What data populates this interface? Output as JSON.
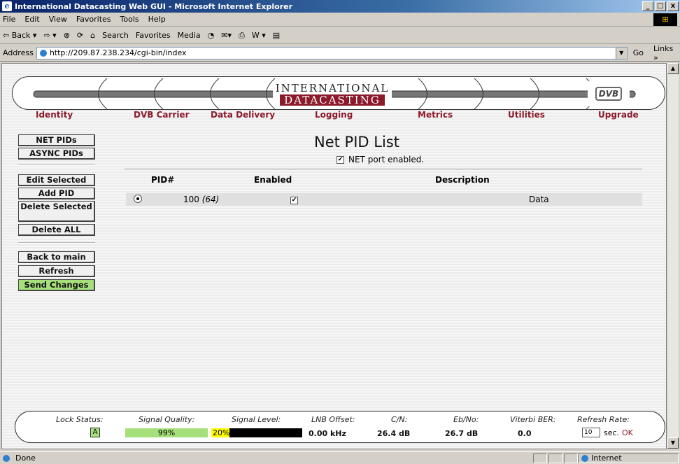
{
  "window": {
    "title": "International Datacasting Web GUI - Microsoft Internet Explorer",
    "controls": [
      "_",
      "□",
      "x"
    ]
  },
  "menubar": [
    "File",
    "Edit",
    "View",
    "Favorites",
    "Tools",
    "Help"
  ],
  "toolbar": {
    "back": "⇦ Back ▾",
    "forward": "⇨ ▾",
    "stop": "⊗",
    "refresh": "⟳",
    "home": "⌂",
    "search": "Search",
    "favorites": "Favorites",
    "media": "Media",
    "history": "◔",
    "mail": "✉▾",
    "print": "⎙",
    "edit": "W ▾",
    "discuss": "▤"
  },
  "address": {
    "label": "Address",
    "url": "http://209.87.238.234/cgi-bin/index",
    "go": "Go",
    "links": "Links »"
  },
  "banner": {
    "logo_line1": "INTERNATIONAL",
    "logo_line2": "DATACASTING",
    "dvb": "DVB"
  },
  "nav": [
    {
      "label": "Identity"
    },
    {
      "label": "DVB Carrier"
    },
    {
      "label": "Data Delivery"
    },
    {
      "label": "Logging"
    },
    {
      "label": "Metrics"
    },
    {
      "label": "Utilities"
    },
    {
      "label": "Upgrade"
    }
  ],
  "sidemenu": {
    "net_pids": "NET PIDs",
    "async_pids": "ASYNC PIDs",
    "edit_selected": "Edit Selected",
    "add_pid": "Add PID",
    "delete_selected": "Delete Selected",
    "delete_all": "Delete ALL",
    "back_to_main": "Back to main",
    "refresh": "Refresh",
    "send_changes": "Send Changes"
  },
  "content": {
    "title": "Net PID List",
    "net_port_label": "NET port enabled.",
    "net_port_checked": true,
    "columns": {
      "pid": "PID#",
      "enabled": "Enabled",
      "description": "Description"
    },
    "rows": [
      {
        "pid": "100",
        "pid_hex": "(64)",
        "enabled": true,
        "description": "Data",
        "selected": true
      }
    ]
  },
  "status": {
    "lock_label": "Lock Status:",
    "lock_value": "A",
    "signal_quality_label": "Signal Quality:",
    "signal_quality_value": "99%",
    "signal_quality_fraction": 0.99,
    "signal_level_label": "Signal Level:",
    "signal_level_value": "20%",
    "signal_level_fraction": 0.2,
    "lnb_label": "LNB Offset:",
    "lnb_value": "0.00 kHz",
    "cn_label": "C/N:",
    "cn_value": "26.4 dB",
    "ebno_label": "Eb/No:",
    "ebno_value": "26.7 dB",
    "ber_label": "Viterbi BER:",
    "ber_value": "0.0",
    "refresh_label": "Refresh Rate:",
    "refresh_value": "10",
    "refresh_unit": "sec.",
    "refresh_ok": "OK"
  },
  "iestatus": {
    "text": "Done",
    "zone": "Internet"
  },
  "colors": {
    "nav": "#8b1a2b",
    "green": "#a6e07a",
    "yellow": "#ffff00"
  }
}
